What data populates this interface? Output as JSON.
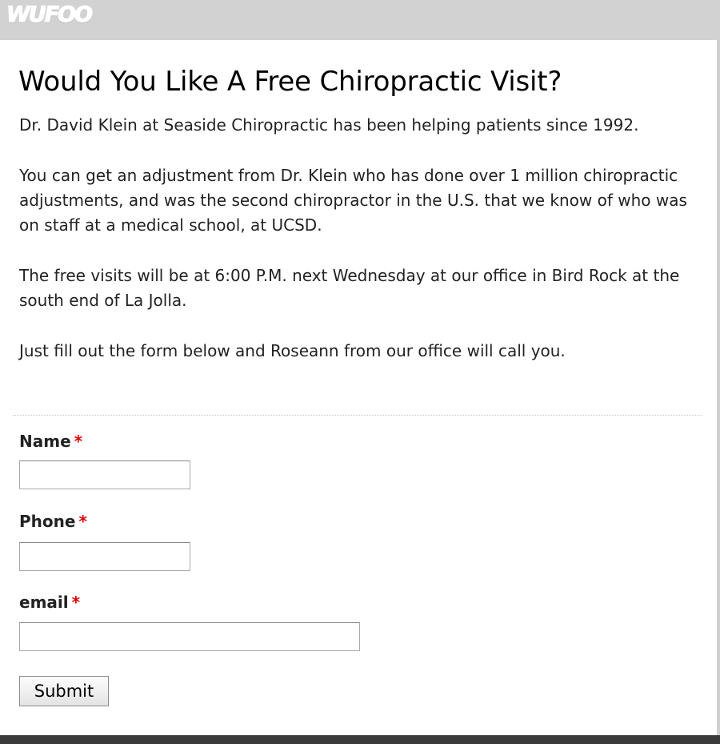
{
  "header": {
    "logo_text": "WUFOO",
    "bar_color": "#d2d2d2"
  },
  "form": {
    "title": "Would You Like A Free Chiropractic Visit?",
    "intro": [
      "Dr. David Klein at Seaside Chiropractic has been helping patients since 1992.",
      "You can get an adjustment from Dr. Klein who has done over 1 million chiropractic adjustments, and was the second chiropractor in the U.S. that we know of who was on staff at a medical school, at UCSD.",
      "The free visits will be at 6:00 P.M. next Wednesday at our office in Bird Rock at the south end of La Jolla.",
      "Just fill out the form below and Roseann from our office will call you."
    ],
    "fields": {
      "name": {
        "label": "Name",
        "required_marker": "*",
        "value": ""
      },
      "phone": {
        "label": "Phone",
        "required_marker": "*",
        "value": ""
      },
      "email": {
        "label": "email",
        "required_marker": "*",
        "value": ""
      }
    },
    "submit_label": "Submit",
    "required_color": "#df0000"
  }
}
